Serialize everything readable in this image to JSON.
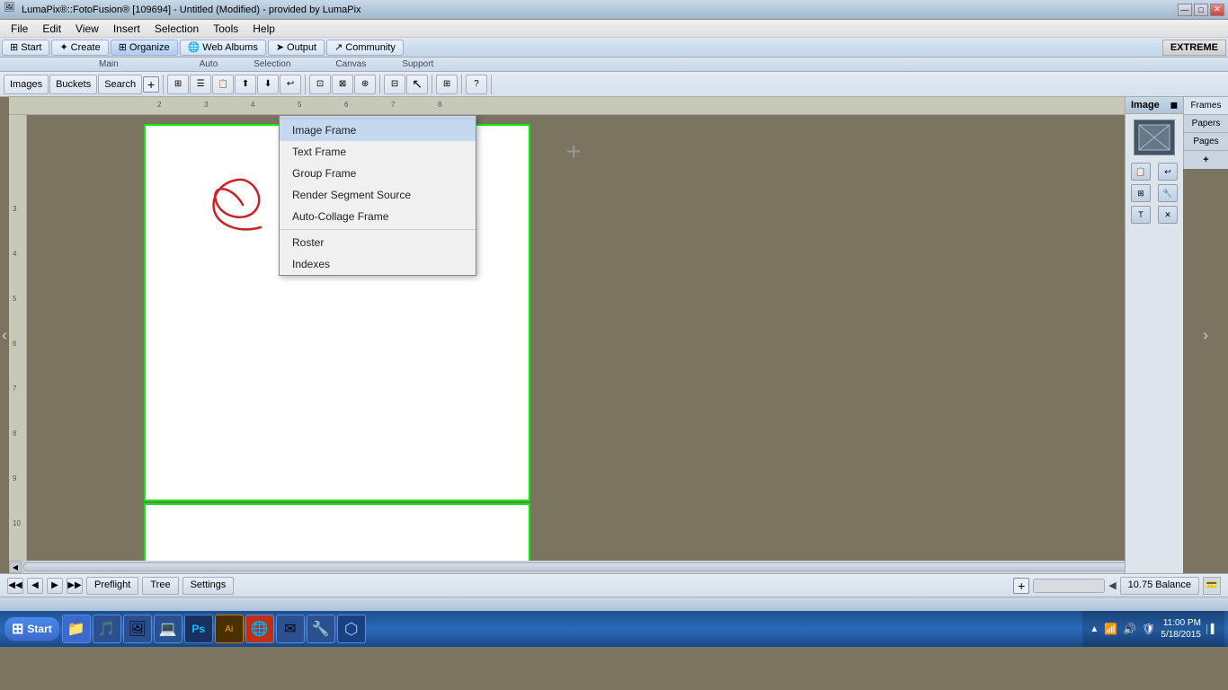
{
  "titlebar": {
    "title": "LumaPix®::FotoFusion® [109694] - Untitled (Modified) - provided by LumaPix",
    "minimize": "—",
    "maximize": "□",
    "close": "✕"
  },
  "menubar": {
    "items": [
      "File",
      "Edit",
      "View",
      "Insert",
      "Selection",
      "Tools",
      "Help"
    ]
  },
  "ribbon": {
    "buttons": [
      {
        "label": "Start",
        "icon": "⊞"
      },
      {
        "label": "Create",
        "icon": "✦"
      },
      {
        "label": "Organize",
        "icon": "⊞"
      },
      {
        "label": "Web Albums",
        "icon": "🌐"
      },
      {
        "label": "Output",
        "icon": "➤"
      },
      {
        "label": "Community",
        "icon": "↗"
      }
    ],
    "extreme": "EXTREME"
  },
  "section_labels": {
    "main": "Main",
    "auto": "Auto",
    "selection": "Selection",
    "canvas": "Canvas",
    "support": "Support"
  },
  "toolbar": {
    "left_buttons": [
      "Images",
      "Buckets",
      "Search"
    ],
    "plus_label": "+"
  },
  "dropdown": {
    "items": [
      "Image Frame",
      "Text Frame",
      "Group Frame",
      "Render Segment Source",
      "Auto-Collage Frame",
      "Roster",
      "Indexes"
    ]
  },
  "image_panel": {
    "title": "Image",
    "close": "◼"
  },
  "bottom_bar": {
    "nav_buttons": [
      "◀◀",
      "◀",
      "▶",
      "▶▶"
    ],
    "buttons": [
      "Preflight",
      "Tree",
      "Settings"
    ],
    "balance": "10.75 Balance",
    "plus": "+"
  },
  "status_bar": {
    "scrollbar_plus": "+"
  },
  "taskbar": {
    "start": "Start",
    "icons": [
      "📁",
      "🎵",
      "🖼",
      "💻",
      "Ps",
      "Ai",
      "🌐",
      "✉",
      "🔧",
      "⬡"
    ],
    "time": "11:00 PM",
    "date": "5/18/2015"
  },
  "ruler": {
    "top_marks": [
      "2",
      "3",
      "4",
      "5",
      "6",
      "7",
      "8"
    ],
    "left_marks": [
      "3",
      "4",
      "5",
      "6",
      "7",
      "8",
      "9",
      "10"
    ]
  }
}
